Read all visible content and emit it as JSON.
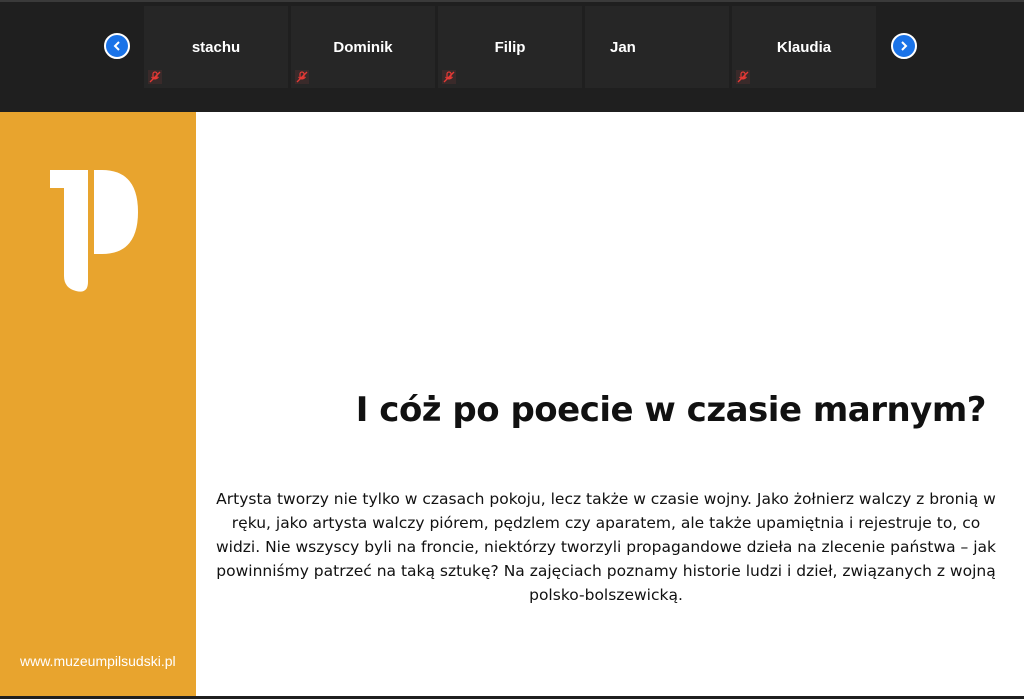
{
  "participants": [
    {
      "name": "stachu",
      "mic": "mic-off-icon"
    },
    {
      "name": "Dominik",
      "mic": "mic-off-icon"
    },
    {
      "name": "Filip",
      "mic": "mic-off-icon"
    },
    {
      "name": "Jan",
      "mic": ""
    },
    {
      "name": "Klaudia",
      "mic": "mic-off-icon"
    }
  ],
  "nav": {
    "prev_icon": "chevron-left-icon",
    "next_icon": "chevron-right-icon"
  },
  "slide": {
    "title": "I cóż po poecie w czasie marnym?",
    "body": "Artysta tworzy nie tylko w czasach pokoju, lecz także w czasie wojny. Jako żołnierz walczy z bronią w ręku, jako artysta walczy piórem, pędzlem czy aparatem, ale także upamiętnia i rejestruje to, co widzi. Nie wszyscy byli na froncie, niektórzy tworzyli propagandowe dzieła na zlecenie państwa – jak powinniśmy patrzeć na taką sztukę? Na zajęciach poznamy historie ludzi i dzieł, związanych z wojną polsko-bolszewicką.",
    "site": "www.muzeumpilsudski.pl",
    "logo": "muzeum-pilsudski-logo"
  },
  "colors": {
    "accent": "#e8a42e",
    "nav_button": "#1a73e8",
    "topbar": "#1f1f1f",
    "tile": "#262626",
    "mic_off": "#e53935"
  }
}
